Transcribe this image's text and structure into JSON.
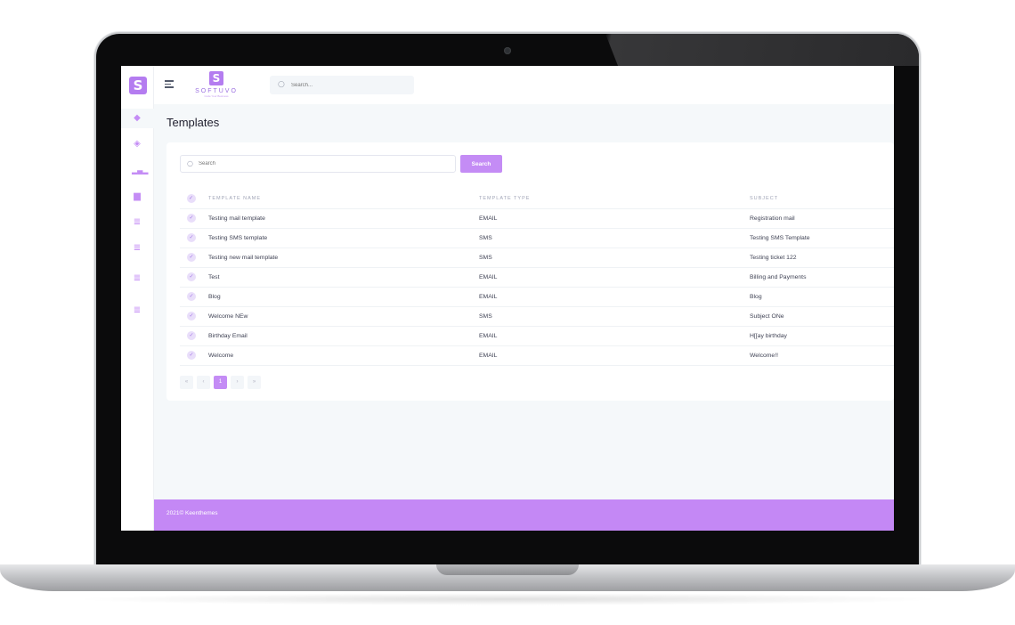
{
  "header": {
    "brand_mark": "S",
    "brand_name": "SOFTUVO",
    "brand_tagline": "Code Your Business",
    "search_placeholder": "Search..."
  },
  "rail": {
    "logo": "S",
    "icons": [
      "diamond-icon",
      "layers-icon",
      "bar-chart-icon",
      "building-icon",
      "stack-icon",
      "stack-icon",
      "stack-icon",
      "stack-icon"
    ]
  },
  "page": {
    "title": "Templates"
  },
  "search": {
    "placeholder": "Search",
    "button_label": "Search"
  },
  "table": {
    "columns": [
      "TEMPLATE NAME",
      "TEMPLATE TYPE",
      "SUBJECT"
    ],
    "rows": [
      {
        "name": "Testing mail template",
        "type": "EMAIL",
        "subject": "Registration mail"
      },
      {
        "name": "Testing SMS template",
        "type": "SMS",
        "subject": "Testing SMS Template"
      },
      {
        "name": "Testing new mail template",
        "type": "SMS",
        "subject": "Testing ticket 122"
      },
      {
        "name": "Test",
        "type": "EMAIL",
        "subject": "Billing and Payments"
      },
      {
        "name": "Blog",
        "type": "EMAIL",
        "subject": "Blog"
      },
      {
        "name": "Welcome NEw",
        "type": "SMS",
        "subject": "Subject ONe"
      },
      {
        "name": "Birthday Email",
        "type": "EMAIL",
        "subject": "H[[ay birthday"
      },
      {
        "name": "Welcome",
        "type": "EMAIL",
        "subject": "Welcome!!"
      }
    ]
  },
  "pagination": {
    "first": "«",
    "prev": "‹",
    "current": "1",
    "next": "›",
    "last": "»"
  },
  "footer": {
    "text": "2021© Keenthemes"
  },
  "colors": {
    "accent": "#c48cf5",
    "footer": "#c488f5"
  }
}
